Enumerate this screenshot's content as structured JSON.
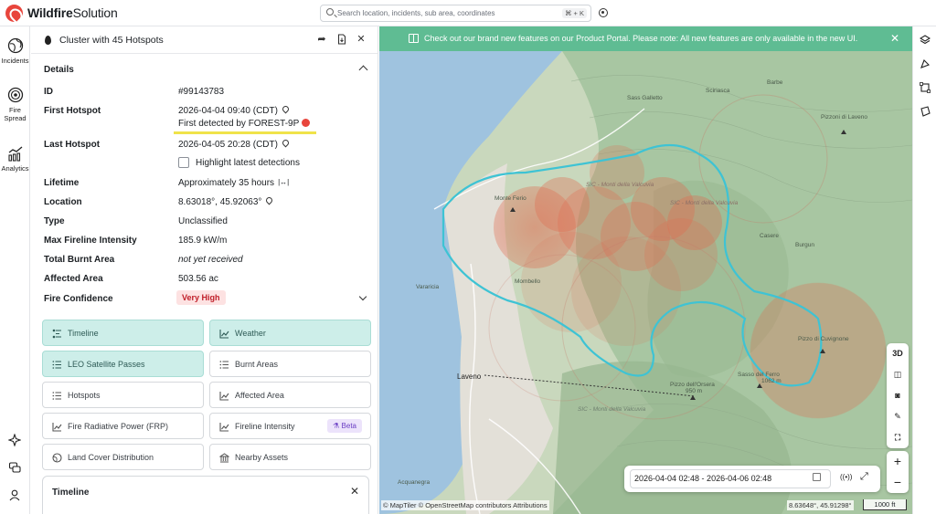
{
  "app": {
    "brand_bold": "Wildfire",
    "brand_light": "Solution"
  },
  "search": {
    "placeholder": "Search location, incidents, sub area, coordinates",
    "shortcut": "⌘ + K"
  },
  "leftnav": {
    "items": [
      {
        "label": "Incidents",
        "icon": "globe-icon"
      },
      {
        "label": "Fire Spread",
        "icon": "fire-spread-icon"
      },
      {
        "label": "Analytics",
        "icon": "analytics-icon"
      }
    ],
    "bottom_icons": [
      "sparkle-icon",
      "chat-icon",
      "user-icon"
    ]
  },
  "panel": {
    "title": "Cluster with 45 Hotspots",
    "section_title": "Details",
    "rows": {
      "id": {
        "label": "ID",
        "value": "#99143783"
      },
      "first_hotspot": {
        "label": "First Hotspot",
        "value": "2026-04-04 09:40 (CDT)",
        "detected_by": "First detected by FOREST-9P"
      },
      "last_hotspot": {
        "label": "Last Hotspot",
        "value": "2026-04-05 20:28 (CDT)"
      },
      "highlight": {
        "label": "Highlight latest detections"
      },
      "lifetime": {
        "label": "Lifetime",
        "value": "Approximately 35 hours"
      },
      "location": {
        "label": "Location",
        "value": "8.63018°, 45.92063°"
      },
      "type": {
        "label": "Type",
        "value": "Unclassified"
      },
      "fireline": {
        "label": "Max Fireline Intensity",
        "value": "185.9 kW/m"
      },
      "burnt": {
        "label": "Total Burnt Area",
        "value": "not yet received"
      },
      "affected": {
        "label": "Affected Area",
        "value": "503.56 ac"
      },
      "confidence": {
        "label": "Fire Confidence",
        "value": "Very High"
      }
    },
    "buttons": {
      "timeline": "Timeline",
      "weather": "Weather",
      "leo": "LEO Satellite Passes",
      "burnt_areas": "Burnt Areas",
      "hotspots": "Hotspots",
      "affected_area": "Affected Area",
      "frp": "Fire Radiative Power (FRP)",
      "fireline_intensity": "Fireline Intensity",
      "beta": "Beta",
      "land_cover": "Land Cover Distribution",
      "nearby_assets": "Nearby Assets"
    },
    "timeline_card": {
      "title": "Timeline"
    }
  },
  "map": {
    "banner": "Check out our brand new features on our Product Portal. Please note: All new features are only available in the new UI.",
    "labels": {
      "l1": "Sass Galletto",
      "l2": "Sciriasca",
      "l3": "Barbe",
      "l4": "Pizzoni di Laveno",
      "l5": "SIC - Monti della Valcuvia",
      "l6": "SIC - Monti della Valcuvia",
      "l7": "Monte Ferio",
      "l8": "Casere",
      "l9": "Burgun",
      "l10": "Vararicia",
      "l11": "Mombello",
      "l12": "Laveno",
      "l13": "Pizzo dell'Orsera",
      "l14": "950 m",
      "l15": "Sasso del Ferro",
      "l16": "1062 m",
      "l17": "Pizzo di Cuvignone",
      "l18": "SIC - Monti della Valcuvia",
      "l19": "Acquanegra"
    },
    "tools": [
      "3D",
      "layers-split-icon",
      "camera-icon",
      "ruler-icon",
      "fullscreen-icon"
    ],
    "time_range": "2026-04-04 02:48 - 2026-04-06 02:48",
    "attribution": "© MapTiler © OpenStreetMap contributors Attributions",
    "coords": "8.63648°, 45.91298°",
    "scale": "1000 ft",
    "colors": {
      "fire": "#e06a4e",
      "perimeter": "#3ec3d4",
      "lake": "#9fc3df",
      "terrain": "#a8c6a2"
    }
  }
}
